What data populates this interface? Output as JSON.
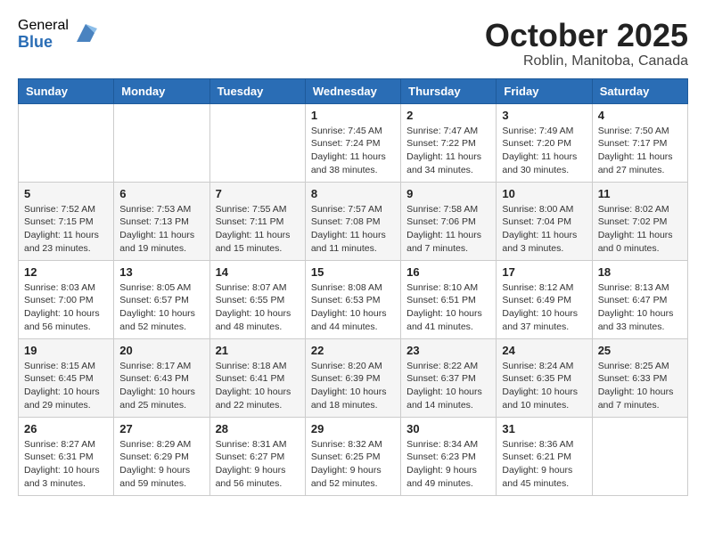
{
  "logo": {
    "general": "General",
    "blue": "Blue"
  },
  "title": "October 2025",
  "location": "Roblin, Manitoba, Canada",
  "days_of_week": [
    "Sunday",
    "Monday",
    "Tuesday",
    "Wednesday",
    "Thursday",
    "Friday",
    "Saturday"
  ],
  "weeks": [
    [
      null,
      null,
      null,
      {
        "day": "1",
        "sunrise": "Sunrise: 7:45 AM",
        "sunset": "Sunset: 7:24 PM",
        "daylight": "Daylight: 11 hours and 38 minutes."
      },
      {
        "day": "2",
        "sunrise": "Sunrise: 7:47 AM",
        "sunset": "Sunset: 7:22 PM",
        "daylight": "Daylight: 11 hours and 34 minutes."
      },
      {
        "day": "3",
        "sunrise": "Sunrise: 7:49 AM",
        "sunset": "Sunset: 7:20 PM",
        "daylight": "Daylight: 11 hours and 30 minutes."
      },
      {
        "day": "4",
        "sunrise": "Sunrise: 7:50 AM",
        "sunset": "Sunset: 7:17 PM",
        "daylight": "Daylight: 11 hours and 27 minutes."
      }
    ],
    [
      {
        "day": "5",
        "sunrise": "Sunrise: 7:52 AM",
        "sunset": "Sunset: 7:15 PM",
        "daylight": "Daylight: 11 hours and 23 minutes."
      },
      {
        "day": "6",
        "sunrise": "Sunrise: 7:53 AM",
        "sunset": "Sunset: 7:13 PM",
        "daylight": "Daylight: 11 hours and 19 minutes."
      },
      {
        "day": "7",
        "sunrise": "Sunrise: 7:55 AM",
        "sunset": "Sunset: 7:11 PM",
        "daylight": "Daylight: 11 hours and 15 minutes."
      },
      {
        "day": "8",
        "sunrise": "Sunrise: 7:57 AM",
        "sunset": "Sunset: 7:08 PM",
        "daylight": "Daylight: 11 hours and 11 minutes."
      },
      {
        "day": "9",
        "sunrise": "Sunrise: 7:58 AM",
        "sunset": "Sunset: 7:06 PM",
        "daylight": "Daylight: 11 hours and 7 minutes."
      },
      {
        "day": "10",
        "sunrise": "Sunrise: 8:00 AM",
        "sunset": "Sunset: 7:04 PM",
        "daylight": "Daylight: 11 hours and 3 minutes."
      },
      {
        "day": "11",
        "sunrise": "Sunrise: 8:02 AM",
        "sunset": "Sunset: 7:02 PM",
        "daylight": "Daylight: 11 hours and 0 minutes."
      }
    ],
    [
      {
        "day": "12",
        "sunrise": "Sunrise: 8:03 AM",
        "sunset": "Sunset: 7:00 PM",
        "daylight": "Daylight: 10 hours and 56 minutes."
      },
      {
        "day": "13",
        "sunrise": "Sunrise: 8:05 AM",
        "sunset": "Sunset: 6:57 PM",
        "daylight": "Daylight: 10 hours and 52 minutes."
      },
      {
        "day": "14",
        "sunrise": "Sunrise: 8:07 AM",
        "sunset": "Sunset: 6:55 PM",
        "daylight": "Daylight: 10 hours and 48 minutes."
      },
      {
        "day": "15",
        "sunrise": "Sunrise: 8:08 AM",
        "sunset": "Sunset: 6:53 PM",
        "daylight": "Daylight: 10 hours and 44 minutes."
      },
      {
        "day": "16",
        "sunrise": "Sunrise: 8:10 AM",
        "sunset": "Sunset: 6:51 PM",
        "daylight": "Daylight: 10 hours and 41 minutes."
      },
      {
        "day": "17",
        "sunrise": "Sunrise: 8:12 AM",
        "sunset": "Sunset: 6:49 PM",
        "daylight": "Daylight: 10 hours and 37 minutes."
      },
      {
        "day": "18",
        "sunrise": "Sunrise: 8:13 AM",
        "sunset": "Sunset: 6:47 PM",
        "daylight": "Daylight: 10 hours and 33 minutes."
      }
    ],
    [
      {
        "day": "19",
        "sunrise": "Sunrise: 8:15 AM",
        "sunset": "Sunset: 6:45 PM",
        "daylight": "Daylight: 10 hours and 29 minutes."
      },
      {
        "day": "20",
        "sunrise": "Sunrise: 8:17 AM",
        "sunset": "Sunset: 6:43 PM",
        "daylight": "Daylight: 10 hours and 25 minutes."
      },
      {
        "day": "21",
        "sunrise": "Sunrise: 8:18 AM",
        "sunset": "Sunset: 6:41 PM",
        "daylight": "Daylight: 10 hours and 22 minutes."
      },
      {
        "day": "22",
        "sunrise": "Sunrise: 8:20 AM",
        "sunset": "Sunset: 6:39 PM",
        "daylight": "Daylight: 10 hours and 18 minutes."
      },
      {
        "day": "23",
        "sunrise": "Sunrise: 8:22 AM",
        "sunset": "Sunset: 6:37 PM",
        "daylight": "Daylight: 10 hours and 14 minutes."
      },
      {
        "day": "24",
        "sunrise": "Sunrise: 8:24 AM",
        "sunset": "Sunset: 6:35 PM",
        "daylight": "Daylight: 10 hours and 10 minutes."
      },
      {
        "day": "25",
        "sunrise": "Sunrise: 8:25 AM",
        "sunset": "Sunset: 6:33 PM",
        "daylight": "Daylight: 10 hours and 7 minutes."
      }
    ],
    [
      {
        "day": "26",
        "sunrise": "Sunrise: 8:27 AM",
        "sunset": "Sunset: 6:31 PM",
        "daylight": "Daylight: 10 hours and 3 minutes."
      },
      {
        "day": "27",
        "sunrise": "Sunrise: 8:29 AM",
        "sunset": "Sunset: 6:29 PM",
        "daylight": "Daylight: 9 hours and 59 minutes."
      },
      {
        "day": "28",
        "sunrise": "Sunrise: 8:31 AM",
        "sunset": "Sunset: 6:27 PM",
        "daylight": "Daylight: 9 hours and 56 minutes."
      },
      {
        "day": "29",
        "sunrise": "Sunrise: 8:32 AM",
        "sunset": "Sunset: 6:25 PM",
        "daylight": "Daylight: 9 hours and 52 minutes."
      },
      {
        "day": "30",
        "sunrise": "Sunrise: 8:34 AM",
        "sunset": "Sunset: 6:23 PM",
        "daylight": "Daylight: 9 hours and 49 minutes."
      },
      {
        "day": "31",
        "sunrise": "Sunrise: 8:36 AM",
        "sunset": "Sunset: 6:21 PM",
        "daylight": "Daylight: 9 hours and 45 minutes."
      },
      null
    ]
  ]
}
